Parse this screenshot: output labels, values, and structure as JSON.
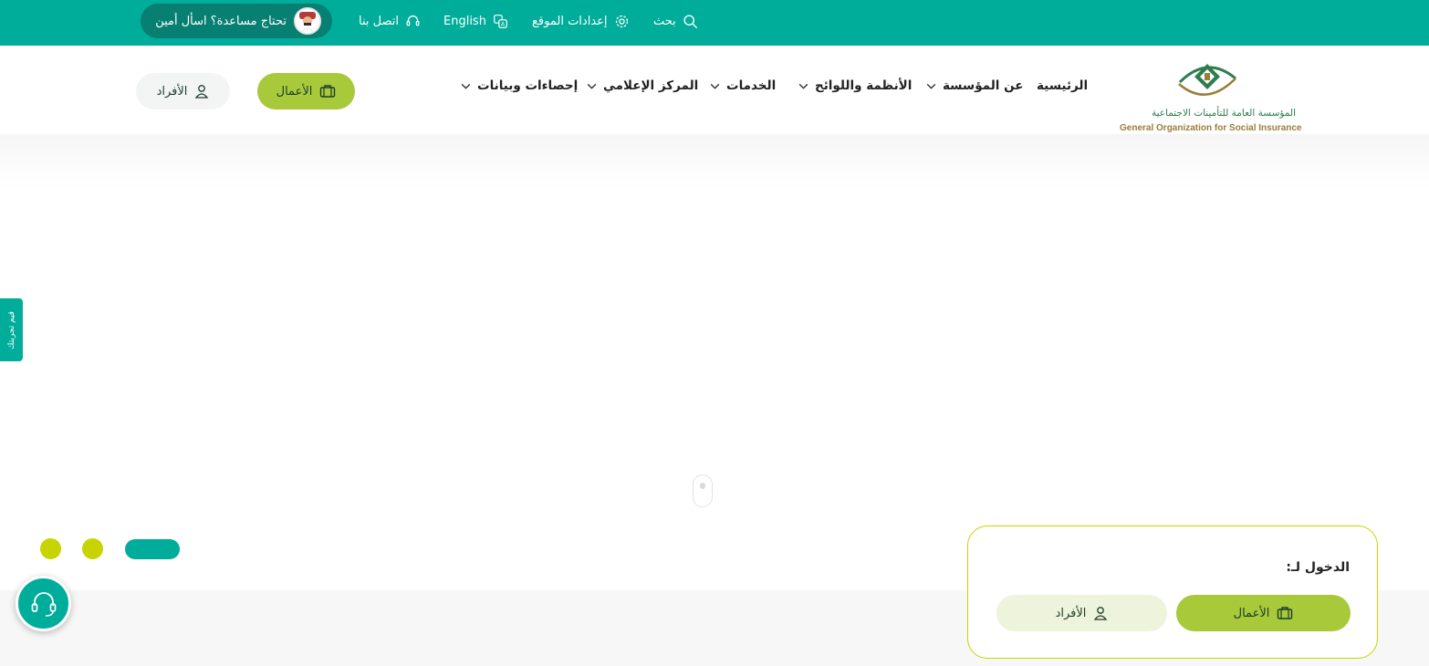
{
  "topbar": {
    "search": "بحث",
    "site_settings": "إعدادات الموقع",
    "language": "English",
    "contact": "اتصل بنا",
    "help": "تحتاج مساعدة؟ اسأل أمين"
  },
  "logo": {
    "arabic": "المؤسسة العامة للتأمينات الاجتماعية",
    "english": "General Organization for Social Insurance"
  },
  "nav": {
    "items": [
      {
        "label": "الرئيسية"
      },
      {
        "label": "عن المؤسسة"
      },
      {
        "label": "الأنظمة واللوائح"
      },
      {
        "label": "الخدمات"
      },
      {
        "label": "المركز الإعلامي"
      },
      {
        "label": "إحصاءات وبيانات"
      }
    ],
    "business_button": "الأعمال",
    "individuals_button": "الأفراد"
  },
  "side_tab": "قيم تجربتك",
  "slider": {
    "total_slides": 3,
    "active_slide": 3
  },
  "login_card": {
    "title": "الدخول لـ:",
    "business_button": "الأعمال",
    "individuals_button": "الأفراد"
  },
  "colors": {
    "primary": "#00ad9a",
    "accent_green": "#a8c93a",
    "dot_yellow": "#c8d400",
    "dark_teal": "#077f72"
  },
  "icons": {
    "search": "search-icon",
    "settings": "gear-icon",
    "language": "translate-icon",
    "contact": "headset-icon",
    "business": "briefcase-icon",
    "individuals": "user-icon",
    "support": "headset-icon"
  }
}
